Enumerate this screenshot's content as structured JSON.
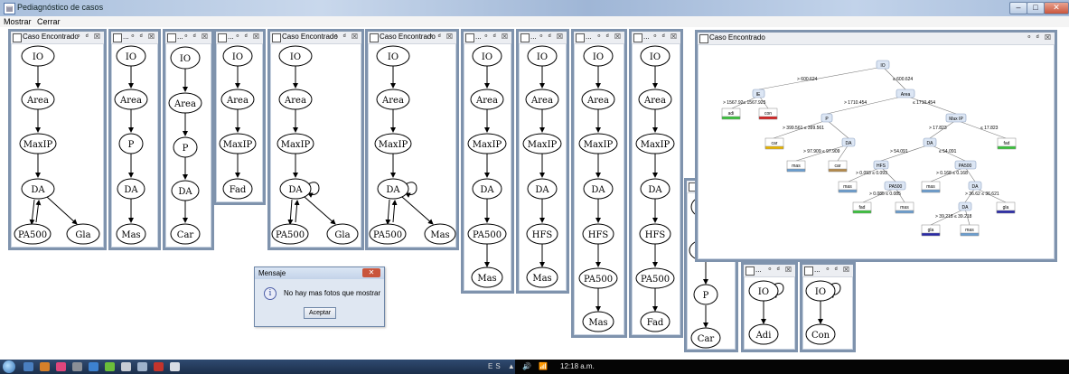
{
  "window": {
    "title": "Pediagnóstico de casos",
    "btn_min": "–",
    "btn_max": "□",
    "btn_close": "✕"
  },
  "menu": [
    "Mostrar",
    "Cerrar"
  ],
  "frame_titles": {
    "found": "Caso Encontrado",
    "short": "..."
  },
  "frame_icons": "ᵒ ᵈ ☒",
  "nodes": {
    "IO": "IO",
    "Area": "Area",
    "MaxIP": "MaxIP",
    "DA": "DA",
    "PA500": "PA500",
    "Gla": "Gla",
    "P": "P",
    "Mas": "Mas",
    "Car": "Car",
    "Fad": "Fad",
    "HFS": "HFS",
    "Adi": "Adi",
    "Con": "Con"
  },
  "tree": {
    "root": "IO",
    "n_e": "IE",
    "n_area": "Area",
    "n_p": "P",
    "n_maxip": "Max IP",
    "n_da1": "DA",
    "n_da2": "DA",
    "n_hfs": "HFS",
    "n_pa500a": "PA500",
    "n_pa500b": "PA500",
    "n_da3": "DA",
    "n_da4": "DA",
    "e_gt600": "> 600.624",
    "e_le600": "≤ 600.624",
    "e_gt1567": "> 1567.92≤ 1567.925",
    "e_gt1710": "> 1710.454",
    "e_le1710": "≤ 1710.454",
    "e_399": "> 399.561  ≤ 399.561",
    "e_gt17": "> 17.823",
    "e_le17": "≤ 17.823",
    "e_97": "> 97.909  ≤ 97.909",
    "e_gt54": "> 54.091",
    "e_le54": "≤ 54.091",
    "e_0093": "> 0.093    ≤ 0.093",
    "e_0168": "> 0.168    ≤ 0.168",
    "e_0085": "> 0.085    ≤ 0.085",
    "e_36": "> 36.62 ≤ 36.621",
    "e_39": "> 39.218  ≤ 39.218",
    "l_adi": "adi",
    "l_con": "con",
    "l_car1": "car",
    "l_fad": "fad",
    "l_mas1": "mas",
    "l_car2": "car",
    "l_mas2": "mas",
    "l_mas3": "mas",
    "l_fad2": "fad",
    "l_mas4": "mas",
    "l_gla1": "gla",
    "l_gla2": "gla",
    "l_mas5": "mas"
  },
  "dialog": {
    "title": "Mensaje",
    "close": "✕",
    "icon": "i",
    "message": "No hay mas fotos que mostrar",
    "button": "Aceptar"
  },
  "taskbar": {
    "clock": "12:18 a.m.",
    "tray": "ES ▲ 🔊 📶"
  },
  "colors": {
    "leaf_green": "#39c23a",
    "leaf_red": "#d42020",
    "leaf_yellow": "#e8b400",
    "leaf_blue": "#2a2aa8",
    "frame_border": "#7f93ad"
  }
}
